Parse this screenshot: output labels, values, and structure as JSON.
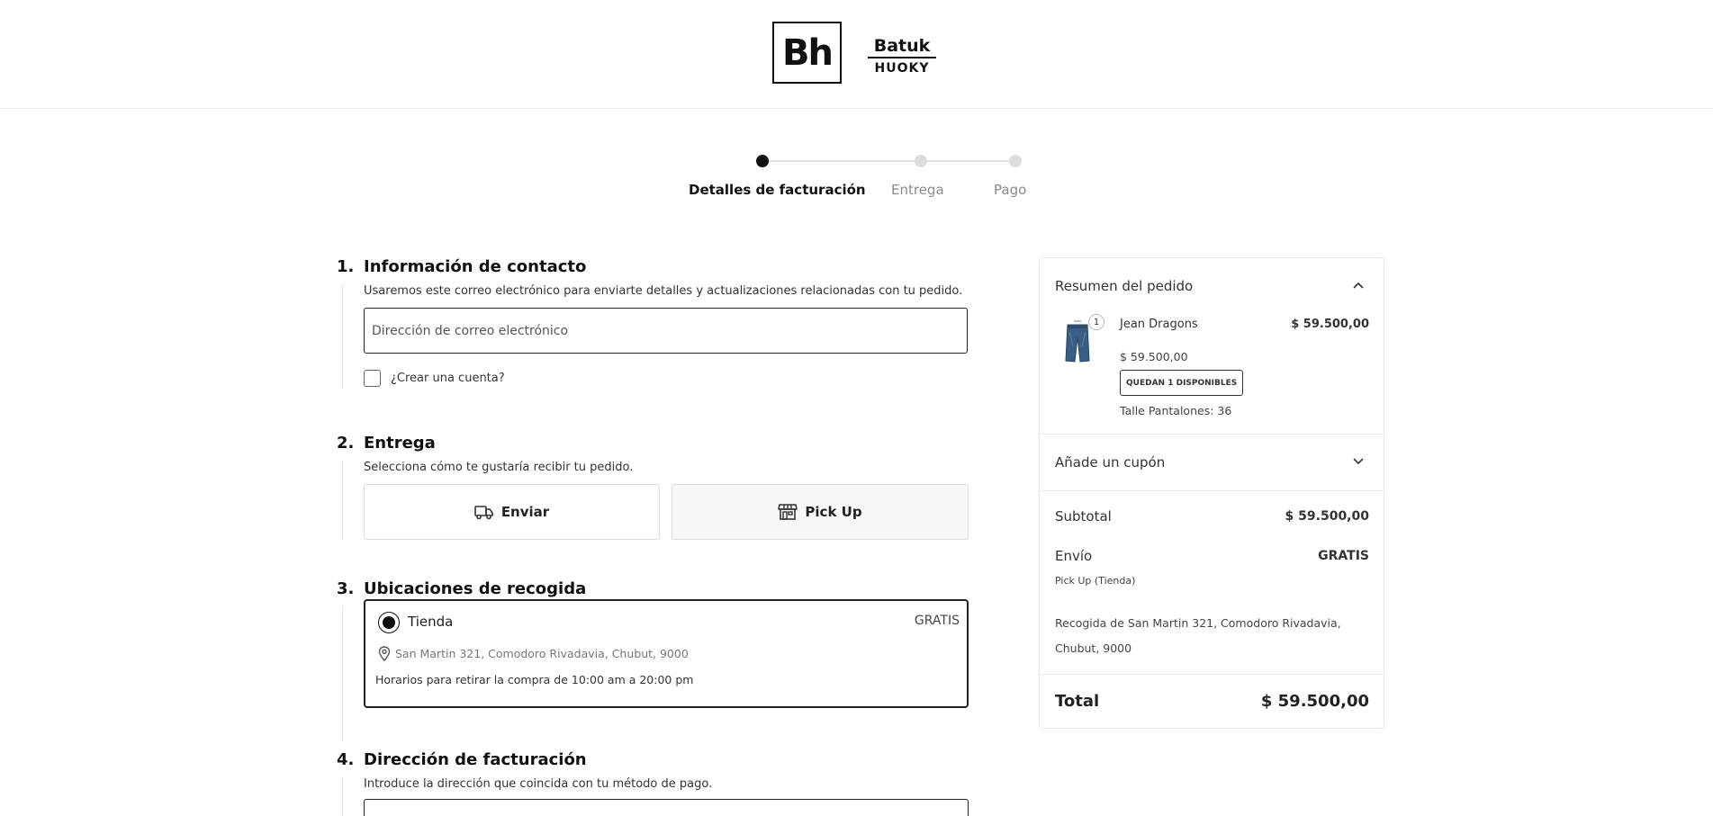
{
  "header": {
    "logo_left": "Bh",
    "logo_right_top": "Batuk",
    "logo_right_bottom": "HUOKY"
  },
  "stepper": {
    "steps": [
      {
        "label": "Detalles de facturación",
        "active": true
      },
      {
        "label": "Entrega",
        "active": false
      },
      {
        "label": "Pago",
        "active": false
      }
    ]
  },
  "sections": {
    "contact": {
      "number": "1.",
      "title": "Información de contacto",
      "description": "Usaremos este correo electrónico para enviarte detalles y actualizaciones relacionadas con tu pedido.",
      "email_placeholder": "Dirección de correo electrónico",
      "create_account_label": "¿Crear una cuenta?"
    },
    "delivery": {
      "number": "2.",
      "title": "Entrega",
      "description": "Selecciona cómo te gustaría recibir tu pedido.",
      "options": [
        "Enviar",
        "Pick Up"
      ],
      "selected": "Pick Up"
    },
    "pickup": {
      "number": "3.",
      "title": "Ubicaciones de recogida",
      "location": {
        "name": "Tienda",
        "price": "GRATIS",
        "address": "San Martin 321, Comodoro Rivadavia, Chubut, 9000",
        "hours": "Horarios para retirar la compra de 10:00 am a 20:00 pm",
        "selected": true
      }
    },
    "billing": {
      "number": "4.",
      "title": "Dirección de facturación",
      "description": "Introduce la dirección que coincida con tu método de pago."
    }
  },
  "summary": {
    "heading": "Resumen del pedido",
    "item": {
      "quantity": "1",
      "name": "Jean Dragons",
      "line_total": "$ 59.500,00",
      "unit_price": "$ 59.500,00",
      "stock_badge": "QUEDAN 1 DISPONIBLES",
      "size": "Talle Pantalones: 36"
    },
    "coupon_label": "Añade un cupón",
    "subtotal_label": "Subtotal",
    "subtotal_value": "$ 59.500,00",
    "shipping_label": "Envío",
    "shipping_value": "GRATIS",
    "shipping_method": "Pick Up (Tienda)",
    "pickup_address": "Recogida de San Martin 321, Comodoro Rivadavia, Chubut, 9000",
    "total_label": "Total",
    "total_value": "$ 59.500,00"
  }
}
